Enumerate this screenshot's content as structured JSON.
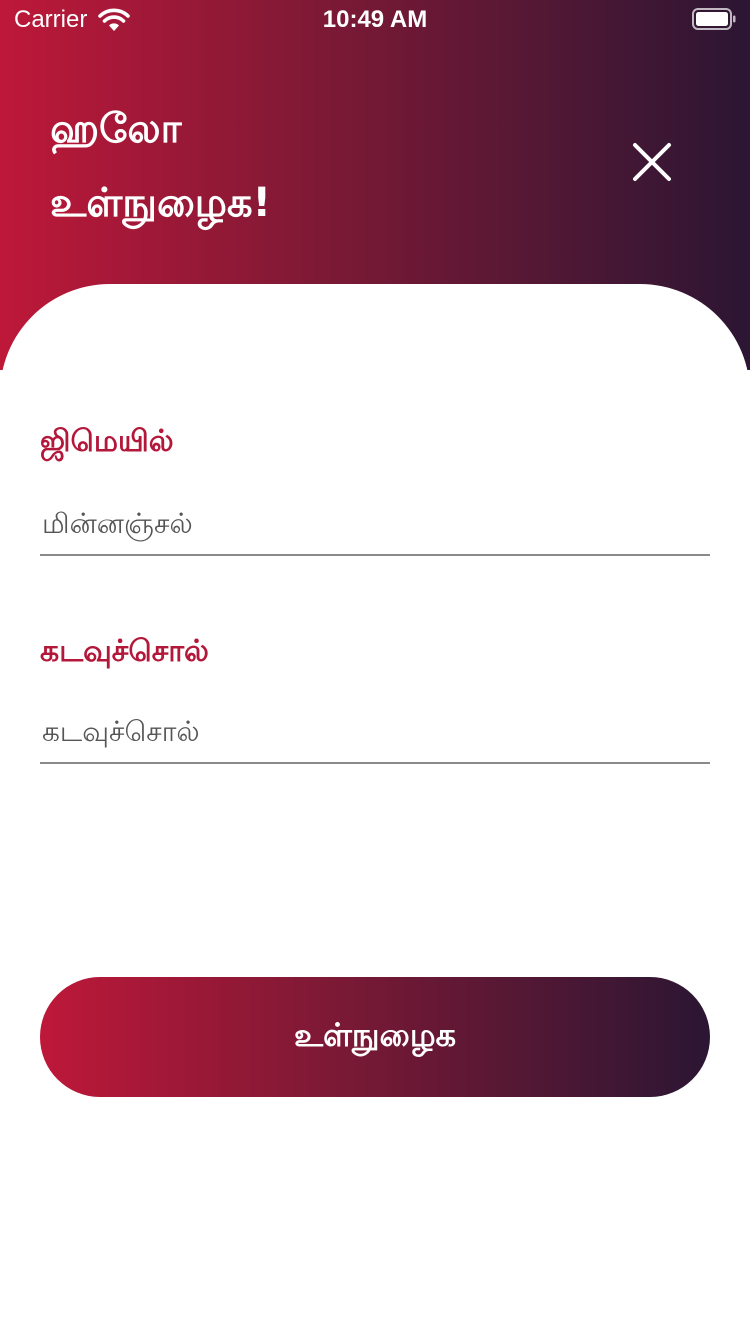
{
  "status_bar": {
    "carrier": "Carrier",
    "time": "10:49 AM",
    "wifi_icon": "wifi-icon",
    "battery_icon": "battery-icon"
  },
  "header": {
    "line1": "ஹலோ",
    "line2": "உள்நுழைக!",
    "close_icon": "close-icon"
  },
  "form": {
    "email_label": "ஜிமெயில்",
    "email_placeholder": "மின்னஞ்சல்",
    "email_value": "",
    "password_label": "கடவுச்சொல்",
    "password_placeholder": "கடவுச்சொல்",
    "password_value": ""
  },
  "actions": {
    "login_label": "உள்நுழைக"
  },
  "colors": {
    "gradient_start": "#be1839",
    "gradient_mid": "#7a1935",
    "gradient_end": "#2b1633",
    "label_accent": "#b3173a"
  }
}
